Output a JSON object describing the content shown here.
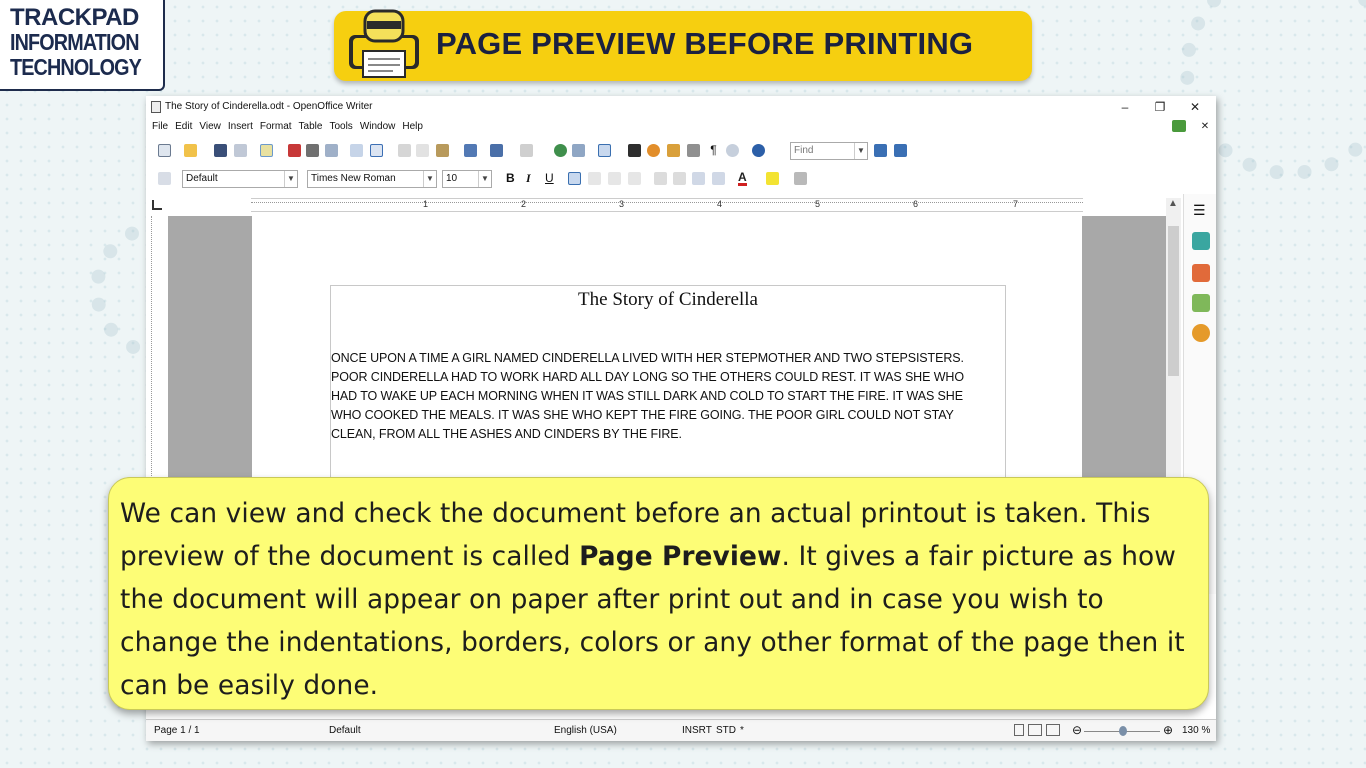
{
  "logo": {
    "line1": "TRACKPAD",
    "line2": "INFORMATION",
    "line3": "TECHNOLOGY"
  },
  "banner": {
    "title": "PAGE PREVIEW BEFORE PRINTING"
  },
  "window": {
    "title": "The Story of Cinderella.odt - OpenOffice Writer",
    "controls": {
      "minimize": "–",
      "restore": "❐",
      "close": "✕",
      "doc_close": "✕"
    }
  },
  "menu": [
    "File",
    "Edit",
    "View",
    "Insert",
    "Format",
    "Table",
    "Tools",
    "Window",
    "Help"
  ],
  "toolbar": {
    "find_placeholder": "Find"
  },
  "formatting": {
    "style": "Default",
    "font": "Times New Roman",
    "size": "10",
    "bold": "B",
    "italic": "I",
    "underline": "U",
    "font_color_label": "A"
  },
  "ruler": {
    "ticks": [
      "1",
      "2",
      "3",
      "4",
      "5",
      "6",
      "7"
    ]
  },
  "document": {
    "heading": "The Story of Cinderella",
    "body": "ONCE UPON A TIME A GIRL NAMED CINDERELLA LIVED  WITH HER STEPMOTHER AND TWO STEPSISTERS.  POOR CINDERELLA HAD TO WORK HARD ALL DAY LONG SO  THE OTHERS COULD REST. IT WAS SHE WHO HAD TO WAKE UP EACH MORNING WHEN IT WAS STILL DARK AND COLD TO START THE FIRE.  IT WAS SHE WHO COOKED THE MEALS. IT WAS SHE WHO KEPT THE FIRE GOING. THE POOR GIRL COULD NOT STAY CLEAN, FROM ALL THE ASHES AND CINDERS BY THE FIRE."
  },
  "statusbar": {
    "page": "Page 1 / 1",
    "style": "Default",
    "language": "English (USA)",
    "insert_mode": "INSRT",
    "selection_mode": "STD",
    "modified": "*",
    "zoom": "130 %"
  },
  "callout": {
    "text_before": "We can view and check the document before an actual printout is taken. This preview of the document is called ",
    "bold_term": "Page Preview",
    "text_after": ". It gives a fair picture as how the document will appear on paper after print out and in case you wish to change the indentations, borders, colors or any other format of the page then it can be easily done."
  },
  "colors": {
    "banner": "#f6cf10",
    "banner_text": "#1b2140",
    "callout": "#fdfd76",
    "logo_text": "#1c2b4e"
  }
}
